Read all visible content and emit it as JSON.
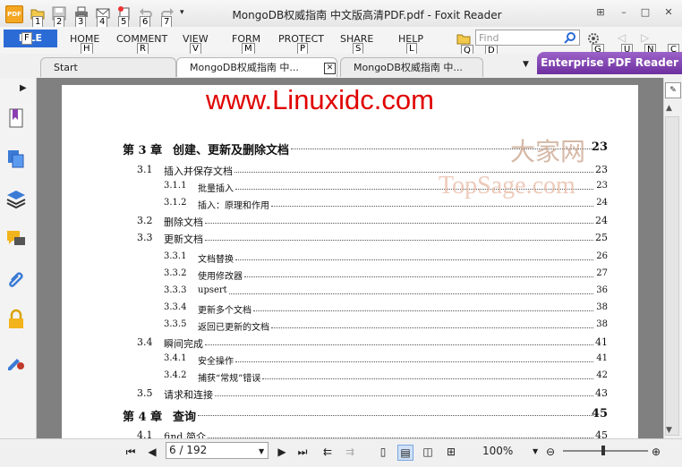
{
  "window": {
    "title": "MongoDB权威指南 中文版高清PDF.pdf - Foxit Reader",
    "app_icon_text": "PDF",
    "controls": [
      "⊞",
      "–",
      "□",
      "✕"
    ]
  },
  "quick_access": {
    "key_tips": [
      "1",
      "2",
      "3",
      "4",
      "5",
      "6",
      "7"
    ],
    "more": "▾"
  },
  "ribbon": {
    "file_label": "FILE",
    "file_key": "F",
    "tabs": [
      {
        "label": "HOME",
        "key": "H"
      },
      {
        "label": "COMMENT",
        "key": "R"
      },
      {
        "label": "VIEW",
        "key": "V"
      },
      {
        "label": "FORM",
        "key": "M"
      },
      {
        "label": "PROTECT",
        "key": "P"
      },
      {
        "label": "SHARE",
        "key": "S"
      },
      {
        "label": "HELP",
        "key": "L"
      }
    ],
    "find_placeholder": "Find",
    "find_key": "Q",
    "find_key2": "D",
    "right_keys": [
      "G",
      "U",
      "N",
      "C"
    ]
  },
  "tabs": [
    {
      "label": "Start"
    },
    {
      "label": "MongoDB权威指南 中..."
    },
    {
      "label": "MongoDB权威指南 中..."
    }
  ],
  "enterprise_label": "Enterprise PDF Reader",
  "document": {
    "watermark_url": "www.Linuxidc.com",
    "watermark_cn": "大家网",
    "watermark_brand": "TopSage.com",
    "toc": [
      {
        "num": "第 3 章",
        "title": "创建、更新及删除文档",
        "page": "23",
        "level": 0
      },
      {
        "num": "3.1",
        "title": "插入并保存文档",
        "page": "23",
        "level": 1
      },
      {
        "num": "3.1.1",
        "title": "批量插入",
        "page": "23",
        "level": 2
      },
      {
        "num": "3.1.2",
        "title": "插入：原理和作用",
        "page": "24",
        "level": 2
      },
      {
        "num": "3.2",
        "title": "删除文档",
        "page": "24",
        "level": 1
      },
      {
        "num": "3.3",
        "title": "更新文档",
        "page": "25",
        "level": 1
      },
      {
        "num": "3.3.1",
        "title": "文档替换",
        "page": "26",
        "level": 2
      },
      {
        "num": "3.3.2",
        "title": "使用修改器",
        "page": "27",
        "level": 2
      },
      {
        "num": "3.3.3",
        "title": "upsert",
        "page": "36",
        "level": 2
      },
      {
        "num": "3.3.4",
        "title": "更新多个文档",
        "page": "38",
        "level": 2
      },
      {
        "num": "3.3.5",
        "title": "返回已更新的文档",
        "page": "38",
        "level": 2
      },
      {
        "num": "3.4",
        "title": "瞬间完成",
        "page": "41",
        "level": 1
      },
      {
        "num": "3.4.1",
        "title": "安全操作",
        "page": "41",
        "level": 2
      },
      {
        "num": "3.4.2",
        "title": "捕获“常规”错误",
        "page": "42",
        "level": 2
      },
      {
        "num": "3.5",
        "title": "请求和连接",
        "page": "43",
        "level": 1
      },
      {
        "num": "第 4 章",
        "title": "查询",
        "page": "45",
        "level": 0
      },
      {
        "num": "4.1",
        "title": "find 简介",
        "page": "45",
        "level": 1
      }
    ]
  },
  "navigation": {
    "page_value": "6 / 192",
    "zoom": "100%",
    "zoom_level_percent": 100
  },
  "colors": {
    "file_tab": "#2b6bd6",
    "enterprise": "#7b3fb0",
    "watermark_red": "#e00000"
  }
}
